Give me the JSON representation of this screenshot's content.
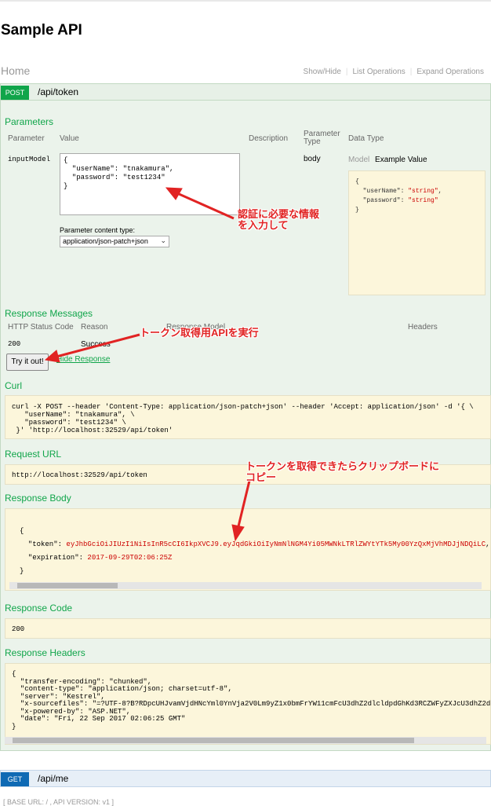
{
  "app": {
    "title": "Sample API"
  },
  "home": {
    "title": "Home",
    "links": [
      "Show/Hide",
      "List Operations",
      "Expand Operations"
    ]
  },
  "post_endpoint": {
    "method": "POST",
    "path": "/api/token",
    "parameters": {
      "title": "Parameters",
      "headers": {
        "parameter": "Parameter",
        "value": "Value",
        "description": "Description",
        "param_type": "Parameter\nType",
        "data_type": "Data Type"
      },
      "row": {
        "name": "inputModel",
        "value": "{\n  \"userName\": \"tnakamura\",\n  \"password\": \"test1234\"\n}",
        "content_type_label": "Parameter content type:",
        "content_type": "application/json-patch+json",
        "param_type": "body",
        "model_tabs": [
          "Model",
          "Example Value"
        ],
        "example": "{\n  \"userName\": \"string\",\n  \"password\": \"string\"\n}"
      }
    },
    "responses": {
      "title": "Response Messages",
      "headers": {
        "code": "HTTP Status Code",
        "reason": "Reason",
        "model": "Response Model",
        "headers": "Headers"
      },
      "row": {
        "code": "200",
        "reason": "Success"
      }
    },
    "try_button": "Try it out!",
    "hide_response": "Hide Response",
    "curl": {
      "title": "Curl",
      "text": "curl -X POST --header 'Content-Type: application/json-patch+json' --header 'Accept: application/json' -d '{ \\\n   \"userName\": \"tnakamura\", \\\n   \"password\": \"test1234\" \\\n }' 'http://localhost:32529/api/token'"
    },
    "request_url": {
      "title": "Request URL",
      "text": "http://localhost:32529/api/token"
    },
    "response_body": {
      "title": "Response Body",
      "token": "eyJhbGciOiJIUzI1NiIsInR5cCI6IkpXVCJ9.eyJqdGkiOiIyNmNlNGM4Yi05MWNkLTRlZWYtYTk5My00YzQxMjVhMDJjNDQiLC",
      "expiration": "2017-09-29T02:06:25Z"
    },
    "response_code": {
      "title": "Response Code",
      "text": "200"
    },
    "response_headers": {
      "title": "Response Headers",
      "text": "{\n  \"transfer-encoding\": \"chunked\",\n  \"content-type\": \"application/json; charset=utf-8\",\n  \"server\": \"Kestrel\",\n  \"x-sourcefiles\": \"=?UTF-8?B?RDpcUHJvamVjdHNcYml0YnVja2V0Lm9yZ1x0bmFrYW11cmFcU3dhZ2dlcldpdGhKd3RCZWFyZXJcU3dhZ2d\",\n  \"x-powered-by\": \"ASP.NET\",\n  \"date\": \"Fri, 22 Sep 2017 02:06:25 GMT\"\n}"
    }
  },
  "get_endpoint": {
    "method": "GET",
    "path": "/api/me"
  },
  "annotations": {
    "note1": "認証に必要な情報\nを入力して",
    "note2": "トークン取得用APIを実行",
    "note3": "トークンを取得できたらクリップボードに\nコピー"
  },
  "footer": "[ BASE URL: / , API VERSION: v1 ]",
  "colors": {
    "post": "#10a54a",
    "get": "#0f6ab4",
    "annotation": "#e12323"
  }
}
